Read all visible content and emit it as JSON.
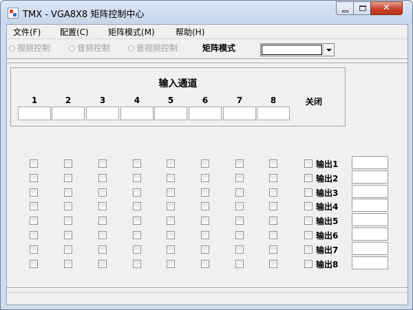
{
  "window": {
    "title": "TMX - VGA8X8 矩阵控制中心",
    "close_glyph": "✕"
  },
  "menu": [
    {
      "label": "文件(F)"
    },
    {
      "label": "配置(C)"
    },
    {
      "label": "矩阵模式(M)"
    },
    {
      "label": "帮助(H)"
    }
  ],
  "toolbar": {
    "radios": [
      {
        "label": "视频控制"
      },
      {
        "label": "音频控制"
      },
      {
        "label": "音视频控制"
      }
    ],
    "mode_label": "矩阵模式",
    "mode_value": ""
  },
  "input_channels": {
    "title": "输入通道",
    "channels": [
      "1",
      "2",
      "3",
      "4",
      "5",
      "6",
      "7",
      "8"
    ],
    "close_label": "关闭"
  },
  "outputs": [
    {
      "label": "输出1",
      "value": ""
    },
    {
      "label": "输出2",
      "value": ""
    },
    {
      "label": "输出3",
      "value": ""
    },
    {
      "label": "输出4",
      "value": ""
    },
    {
      "label": "输出5",
      "value": ""
    },
    {
      "label": "输出6",
      "value": ""
    },
    {
      "label": "输出7",
      "value": ""
    },
    {
      "label": "输出8",
      "value": ""
    }
  ],
  "colors": {
    "title_bar": "#c6d6ea",
    "close_button": "#c7432c",
    "client_background": "#f0f0f0"
  },
  "icons": [
    "app-icon",
    "minimize-icon",
    "maximize-icon",
    "close-icon",
    "dropdown-arrow-icon"
  ]
}
